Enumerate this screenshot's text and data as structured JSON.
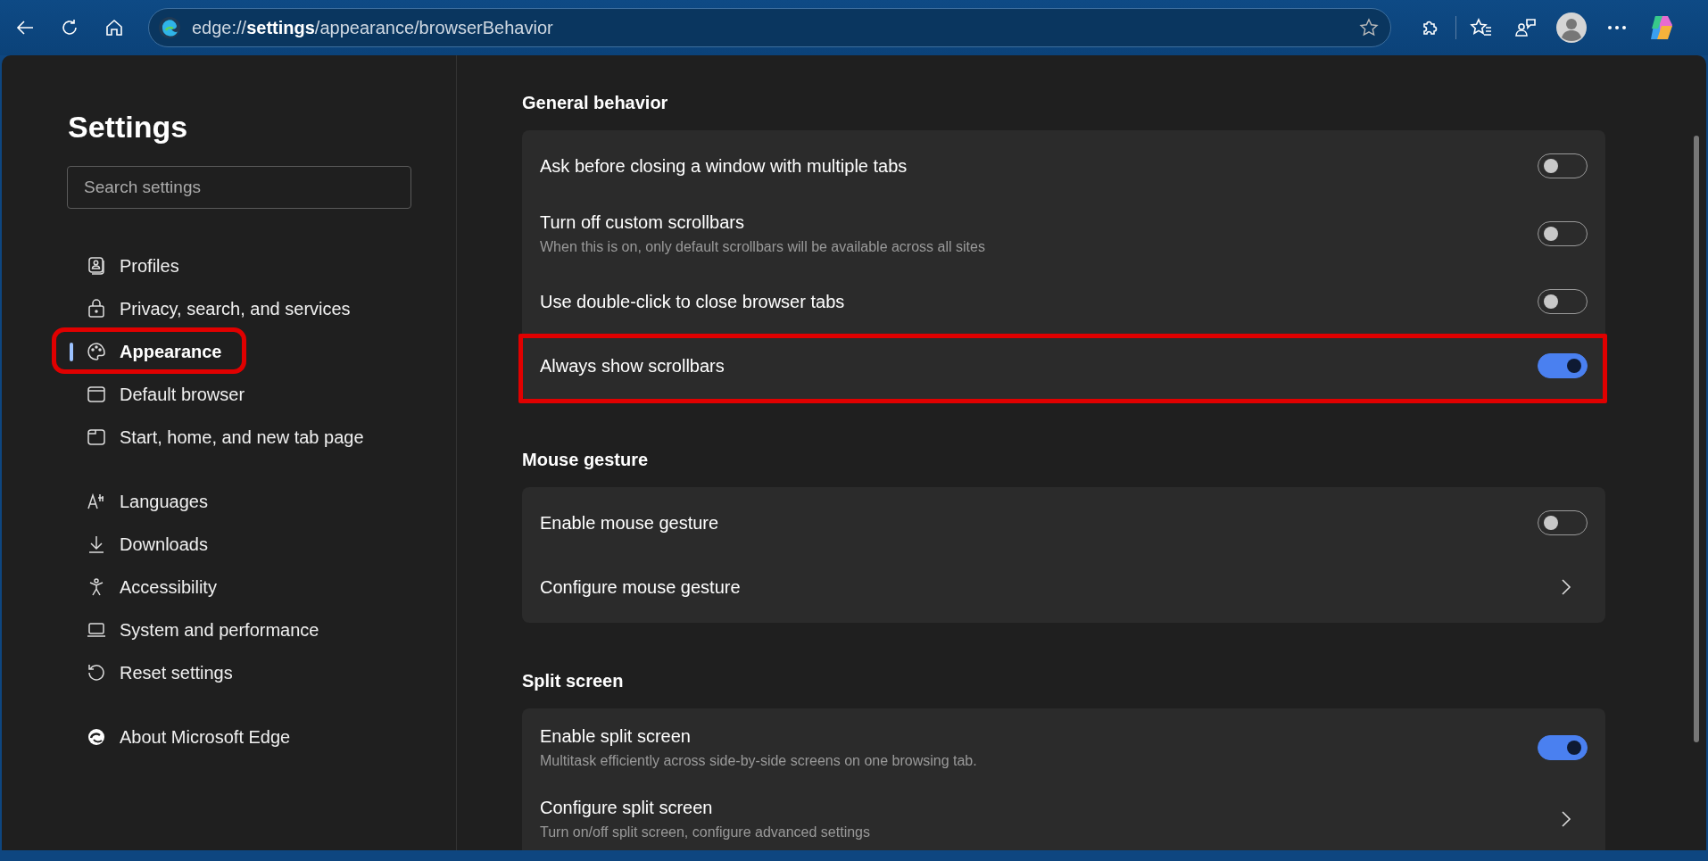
{
  "address_bar": {
    "url": "edge://**settings**/appearance/browserBehavior"
  },
  "sidebar": {
    "title": "Settings",
    "search": {
      "placeholder": "Search settings"
    },
    "groups": [
      [
        {
          "label": "Profiles",
          "selected": false,
          "highlighted": false
        },
        {
          "label": "Privacy, search, and services",
          "selected": false,
          "highlighted": false
        },
        {
          "label": "Appearance",
          "selected": true,
          "highlighted": true
        },
        {
          "label": "Default browser",
          "selected": false,
          "highlighted": false
        },
        {
          "label": "Start, home, and new tab page",
          "selected": false,
          "highlighted": false
        }
      ],
      [
        {
          "label": "Languages",
          "selected": false,
          "highlighted": false
        },
        {
          "label": "Downloads",
          "selected": false,
          "highlighted": false
        },
        {
          "label": "Accessibility",
          "selected": false,
          "highlighted": false
        },
        {
          "label": "System and performance",
          "selected": false,
          "highlighted": false
        },
        {
          "label": "Reset settings",
          "selected": false,
          "highlighted": false
        }
      ],
      [
        {
          "label": "About Microsoft Edge",
          "selected": false,
          "highlighted": false
        }
      ]
    ]
  },
  "sections": [
    {
      "title": "General behavior",
      "rows": [
        {
          "kind": "toggle",
          "label": "Ask before closing a window with multiple tabs",
          "on": false,
          "highlighted": false
        },
        {
          "kind": "toggle",
          "label": "Turn off custom scrollbars",
          "description": "When this is on, only default scrollbars will be available across all sites",
          "on": false,
          "highlighted": false
        },
        {
          "kind": "toggle",
          "label": "Use double-click to close browser tabs",
          "on": false,
          "highlighted": false
        },
        {
          "kind": "toggle",
          "label": "Always show scrollbars",
          "on": true,
          "highlighted": true
        }
      ]
    },
    {
      "title": "Mouse gesture",
      "rows": [
        {
          "kind": "toggle",
          "label": "Enable mouse gesture",
          "on": false,
          "highlighted": false
        },
        {
          "kind": "link",
          "label": "Configure mouse gesture",
          "highlighted": false
        }
      ]
    },
    {
      "title": "Split screen",
      "rows": [
        {
          "kind": "toggle",
          "label": "Enable split screen",
          "description": "Multitask efficiently across side-by-side screens on one browsing tab.",
          "on": true,
          "highlighted": false
        },
        {
          "kind": "link",
          "label": "Configure split screen",
          "description": "Turn on/off split screen, configure advanced settings",
          "highlighted": false
        }
      ]
    }
  ]
}
